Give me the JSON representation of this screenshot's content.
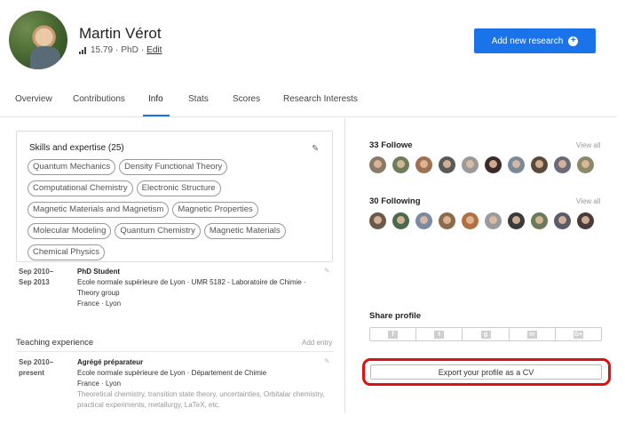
{
  "profile": {
    "name": "Martin Vérot",
    "score": "15.79",
    "degree": "PhD",
    "edit_label": "Edit",
    "separator": "·"
  },
  "header": {
    "add_button_label": "Add new research",
    "accent_color": "#1a73e8"
  },
  "tabs": [
    {
      "label": "Overview"
    },
    {
      "label": "Contributions"
    },
    {
      "label": "Info",
      "active": true
    },
    {
      "label": "Stats"
    },
    {
      "label": "Scores"
    },
    {
      "label": "Research Interests"
    }
  ],
  "skills": {
    "title": "Skills and expertise (25)",
    "items": [
      "Quantum Mechanics",
      "Density Functional Theory",
      "Computational Chemistry",
      "Electronic Structure",
      "Magnetic Materials and Magnetism",
      "Magnetic Properties",
      "Molecular Modeling",
      "Quantum Chemistry",
      "Magnetic Materials",
      "Chemical Physics"
    ]
  },
  "experience": [
    {
      "date_start": "Sep 2010–",
      "date_end": "Sep 2013",
      "role": "PhD Student",
      "org": "Ecole normale supérieure de Lyon · UMR 5182 - Laboratoire de Chimie ·",
      "dept": "Theory group",
      "location": "France · Lyon"
    }
  ],
  "teaching": {
    "title": "Teaching experience",
    "add_label": "Add entry",
    "items": [
      {
        "date_start": "Sep 2010–",
        "date_end": "present",
        "role": "Agrégé préparateur",
        "org": "Ecole normale supérieure de Lyon · Département de Chimie",
        "location": "France · Lyon",
        "description": "Theoretical chemistry, transition state theory, uncertainties, Orbitalar chemistry, practical experiments, metallurgy, LaTeX, etc."
      }
    ]
  },
  "followers": {
    "title": "33 Followe",
    "view_all": "View all",
    "colors": [
      "#8a7a6a",
      "#6d7d5a",
      "#a07050",
      "#5a5a5a",
      "#9a9a9a",
      "#3a2a2a",
      "#7a8a9a",
      "#5a4a3a",
      "#6a6a7a",
      "#8a8a6a"
    ]
  },
  "following": {
    "title": "30 Following",
    "view_all": "View all",
    "colors": [
      "#6a5a4a",
      "#4a6a4a",
      "#7a8aa0",
      "#8a6a4a",
      "#b07040",
      "#9a9aa0",
      "#3a3a3a",
      "#6a7a5a",
      "#5a5a6a",
      "#4a3a3a"
    ]
  },
  "share": {
    "title": "Share profile",
    "networks": [
      {
        "name": "facebook-icon",
        "glyph": "f"
      },
      {
        "name": "twitter-icon",
        "glyph": "t"
      },
      {
        "name": "google-scholar-icon",
        "glyph": "g"
      },
      {
        "name": "linkedin-icon",
        "glyph": "in"
      },
      {
        "name": "google-plus-icon",
        "glyph": "G+"
      }
    ]
  },
  "export": {
    "label": "Export your profile as a CV",
    "highlight_color": "#e01010"
  }
}
